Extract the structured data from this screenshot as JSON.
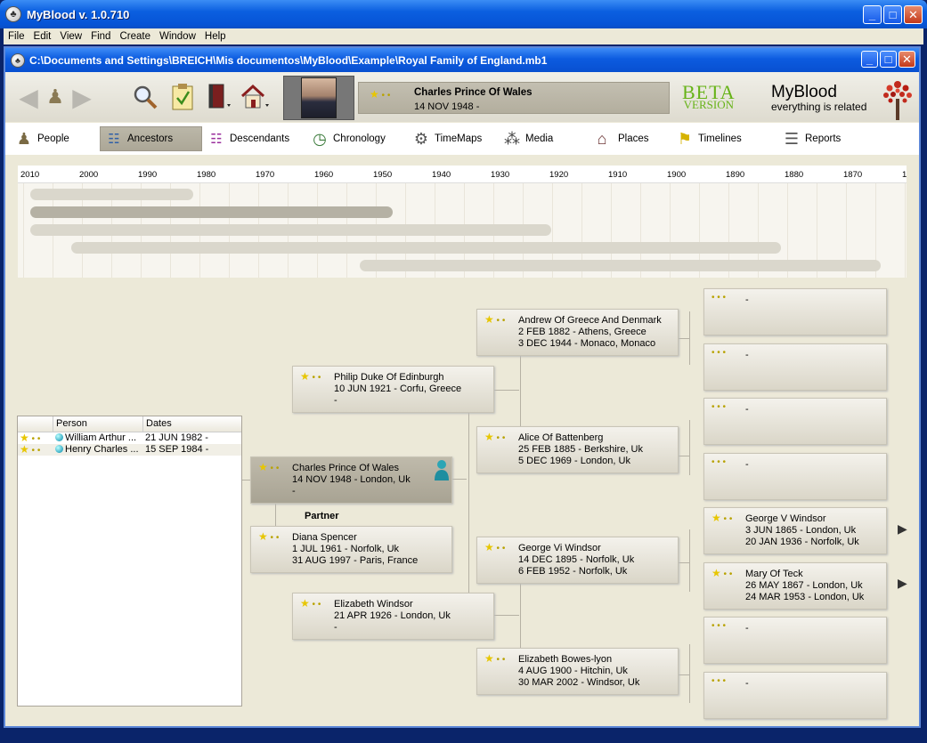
{
  "window": {
    "title": "MyBlood v. 1.0.710"
  },
  "menu": [
    "File",
    "Edit",
    "View",
    "Find",
    "Create",
    "Window",
    "Help"
  ],
  "document": {
    "path": "C:\\Documents and Settings\\BREICH\\Mis documentos\\MyBlood\\Example\\Royal Family of England.mb1"
  },
  "current_person": {
    "name": "Charles Prince Of Wales",
    "date": "14 NOV 1948 -"
  },
  "branding": {
    "beta_line1": "BETA",
    "beta_line2": "VERSION",
    "app": "MyBlood",
    "tagline": "everything is related",
    "accent": "#67b318"
  },
  "tabs": [
    {
      "label": "People",
      "icon": "person-icon"
    },
    {
      "label": "Ancestors",
      "icon": "ancestors-icon",
      "active": true
    },
    {
      "label": "Descendants",
      "icon": "descendants-icon"
    },
    {
      "label": "Chronology",
      "icon": "clock-icon"
    },
    {
      "label": "TimeMaps",
      "icon": "timemap-icon"
    },
    {
      "label": "Media",
      "icon": "media-icon"
    },
    {
      "label": "Places",
      "icon": "house-icon"
    },
    {
      "label": "Timelines",
      "icon": "flag-icon"
    },
    {
      "label": "Reports",
      "icon": "report-icon"
    }
  ],
  "timeline": {
    "years": [
      "2010",
      "2000",
      "1990",
      "1980",
      "1970",
      "1960",
      "1950",
      "1940",
      "1930",
      "1920",
      "1910",
      "1900",
      "1890",
      "1880",
      "1870",
      "1"
    ]
  },
  "children_list": {
    "columns": [
      "Person",
      "Dates"
    ],
    "rows": [
      {
        "name": "William Arthur ...",
        "dates": "21 JUN 1982 -"
      },
      {
        "name": "Henry Charles ...",
        "dates": "15 SEP 1984 -"
      }
    ]
  },
  "tree": {
    "root": {
      "name": "Charles Prince Of Wales",
      "l2": "14 NOV 1948 - London, Uk",
      "l3": "-"
    },
    "partner_label": "Partner",
    "partner": {
      "name": "Diana Spencer",
      "l2": "1 JUL 1961 - Norfolk, Uk",
      "l3": "31 AUG 1997 - Paris, France"
    },
    "father": {
      "name": "Philip Duke Of Edinburgh",
      "l2": "10 JUN 1921 - Corfu, Greece",
      "l3": "-"
    },
    "mother": {
      "name": "Elizabeth Windsor",
      "l2": "21 APR 1926 - London, Uk",
      "l3": "-"
    },
    "ff": {
      "name": "Andrew Of Greece And Denmark",
      "l2": "2 FEB 1882 - Athens, Greece",
      "l3": "3 DEC 1944 - Monaco, Monaco"
    },
    "fm": {
      "name": "Alice Of Battenberg",
      "l2": "25 FEB 1885 - Berkshire, Uk",
      "l3": "5 DEC 1969 - London, Uk"
    },
    "mf": {
      "name": "George Vi Windsor",
      "l2": "14 DEC 1895 - Norfolk, Uk",
      "l3": "6 FEB 1952 - Norfolk, Uk"
    },
    "mm": {
      "name": "Elizabeth Bowes-lyon",
      "l2": "4 AUG 1900 - Hitchin, Uk",
      "l3": "30 MAR 2002 - Windsor, Uk"
    },
    "mff": {
      "name": "George V Windsor",
      "l2": "3 JUN 1865 - London, Uk",
      "l3": "20 JAN 1936 - Norfolk, Uk"
    },
    "mfm": {
      "name": "Mary Of Teck",
      "l2": "26 MAY 1867 - London, Uk",
      "l3": "24 MAR 1953 - London, Uk"
    },
    "empty": "-"
  }
}
